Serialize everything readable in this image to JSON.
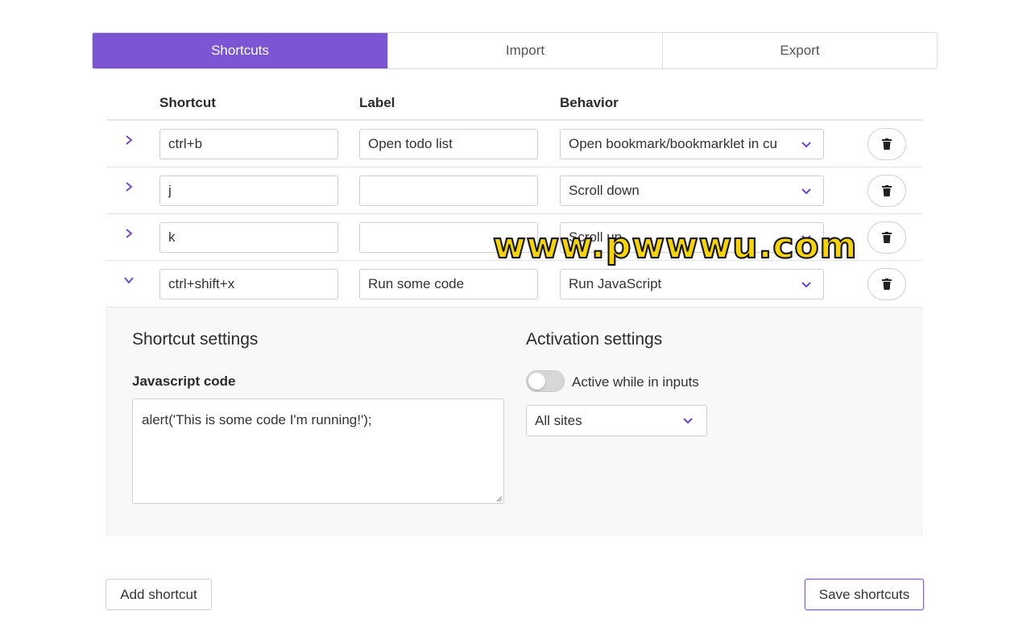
{
  "tabs": [
    {
      "label": "Shortcuts",
      "active": true
    },
    {
      "label": "Import",
      "active": false
    },
    {
      "label": "Export",
      "active": false
    }
  ],
  "table": {
    "headers": {
      "shortcut": "Shortcut",
      "label": "Label",
      "behavior": "Behavior"
    },
    "rows": [
      {
        "expanded": false,
        "shortcut": "ctrl+b",
        "label": "Open todo list",
        "behavior": "Open bookmark/bookmarklet in cu"
      },
      {
        "expanded": false,
        "shortcut": "j",
        "label": "",
        "behavior": "Scroll down"
      },
      {
        "expanded": false,
        "shortcut": "k",
        "label": "",
        "behavior": "Scroll up"
      },
      {
        "expanded": true,
        "shortcut": "ctrl+shift+x",
        "label": "Run some code",
        "behavior": "Run JavaScript"
      }
    ]
  },
  "settings": {
    "shortcut_title": "Shortcut settings",
    "code_label": "Javascript code",
    "code_value": "alert('This is some code I'm running!');",
    "activation_title": "Activation settings",
    "toggle_label": "Active while in inputs",
    "toggle_on": false,
    "site_select": "All sites"
  },
  "buttons": {
    "add": "Add shortcut",
    "save": "Save shortcuts"
  },
  "watermark": "www.pwwwu.com",
  "colors": {
    "accent": "#7b55d4",
    "watermark": "#f5d400"
  },
  "icons": {
    "row_expand": "chevron-right-icon",
    "row_collapse": "chevron-down-icon",
    "delete": "trash-icon",
    "select": "chevron-down-icon"
  }
}
